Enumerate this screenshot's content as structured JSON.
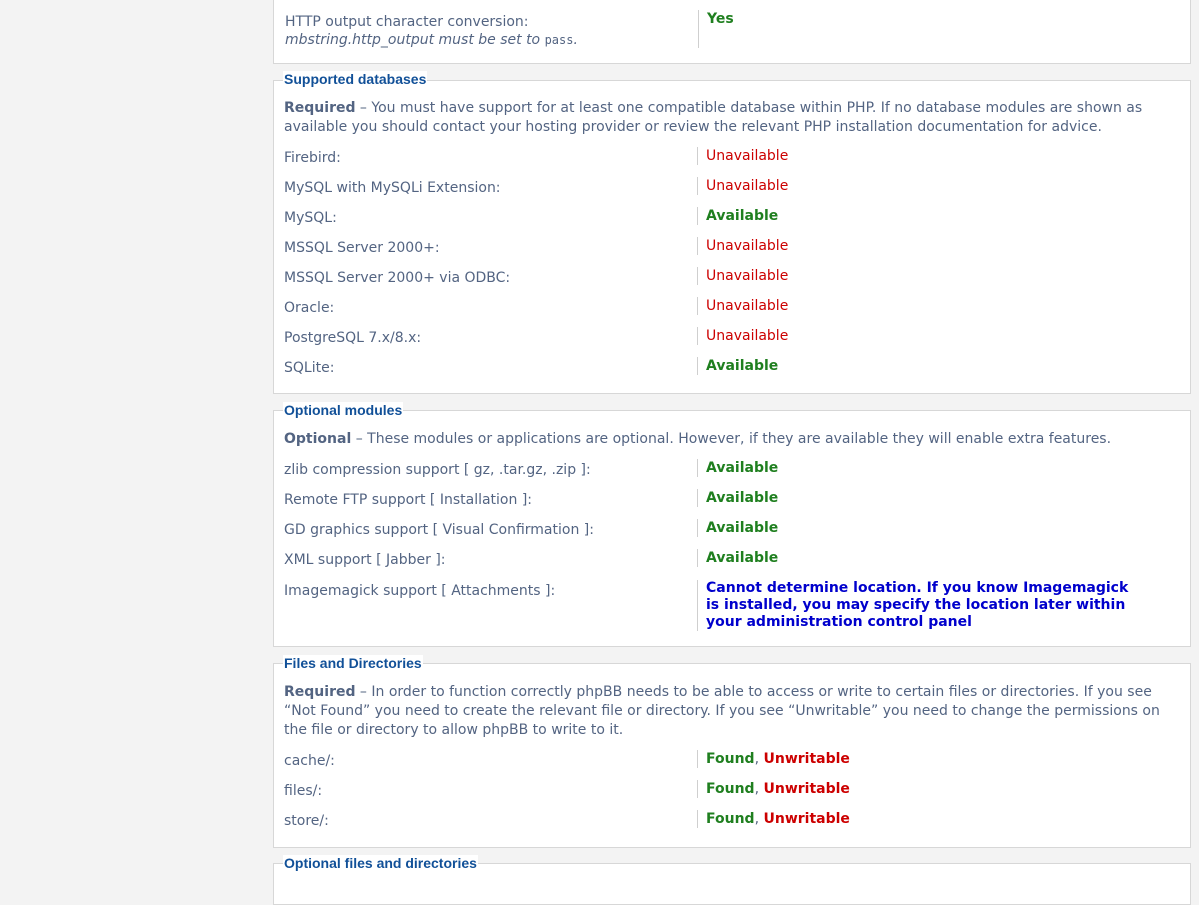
{
  "top_box": {
    "label_line1": "HTTP output character conversion:",
    "label_line2_prefix": "mbstring.http_output must be set to ",
    "label_line2_code": "pass",
    "label_line2_suffix": ".",
    "value": "Yes"
  },
  "supported_databases": {
    "legend": "Supported databases",
    "required_label": "Required",
    "description": " – You must have support for at least one compatible database within PHP. If no database modules are shown as available you should contact your hosting provider or review the relevant PHP installation documentation for advice.",
    "rows": [
      {
        "label": "Firebird:",
        "value": "Unavailable",
        "status": "bad"
      },
      {
        "label": "MySQL with MySQLi Extension:",
        "value": "Unavailable",
        "status": "bad"
      },
      {
        "label": "MySQL:",
        "value": "Available",
        "status": "ok"
      },
      {
        "label": "MSSQL Server 2000+:",
        "value": "Unavailable",
        "status": "bad"
      },
      {
        "label": "MSSQL Server 2000+ via ODBC:",
        "value": "Unavailable",
        "status": "bad"
      },
      {
        "label": "Oracle:",
        "value": "Unavailable",
        "status": "bad"
      },
      {
        "label": "PostgreSQL 7.x/8.x:",
        "value": "Unavailable",
        "status": "bad"
      },
      {
        "label": "SQLite:",
        "value": "Available",
        "status": "ok"
      }
    ]
  },
  "optional_modules": {
    "legend": "Optional modules",
    "optional_label": "Optional",
    "description": " – These modules or applications are optional. However, if they are available they will enable extra features.",
    "rows": [
      {
        "label": "zlib compression support [ gz, .tar.gz, .zip ]:",
        "value": "Available",
        "status": "ok"
      },
      {
        "label": "Remote FTP support [ Installation ]:",
        "value": "Available",
        "status": "ok"
      },
      {
        "label": "GD graphics support [ Visual Confirmation ]:",
        "value": "Available",
        "status": "ok"
      },
      {
        "label": "XML support [ Jabber ]:",
        "value": "Available",
        "status": "ok"
      }
    ],
    "imagemagick_label": "Imagemagick support [ Attachments ]:",
    "imagemagick_value": "Cannot determine location. If you know Imagemagick is installed, you may specify the location later within your administration control panel"
  },
  "files_and_directories": {
    "legend": "Files and Directories",
    "required_label": "Required",
    "description": " – In order to function correctly phpBB needs to be able to access or write to certain files or directories. If you see “Not Found” you need to create the relevant file or directory. If you see “Unwritable” you need to change the permissions on the file or directory to allow phpBB to write to it.",
    "found_label": "Found",
    "separator": ", ",
    "unwritable_label": "Unwritable",
    "rows": [
      {
        "label": "cache/:"
      },
      {
        "label": "files/:"
      },
      {
        "label": "store/:"
      }
    ]
  },
  "optional_files": {
    "legend": "Optional files and directories"
  }
}
